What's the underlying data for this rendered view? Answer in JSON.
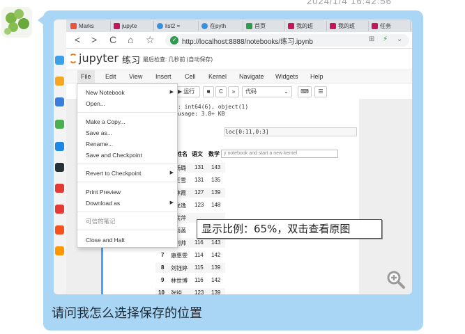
{
  "timestamp": "2024/1/4 16:42:56",
  "message": "请问我怎么选择保存的位置",
  "browser": {
    "tabs": [
      {
        "label": "Marks",
        "color": "#e8553e"
      },
      {
        "label": "jupyte",
        "color": "#c2185b"
      },
      {
        "label": "list2 =",
        "color": "#3b8fd9"
      },
      {
        "label": "在pyth",
        "color": "#3b8fd9"
      },
      {
        "label": "首页",
        "color": "#2e9b4e"
      },
      {
        "label": "我的班",
        "color": "#c2185b"
      },
      {
        "label": "我的班",
        "color": "#c2185b"
      },
      {
        "label": "任务",
        "color": "#c2185b"
      }
    ],
    "url": "http://localhost:8888/notebooks/练习.ipynb"
  },
  "jupyter": {
    "logo": "jupyter",
    "notebook_title": "练习",
    "save_status": "最后检查: 几秒前  (自动保存)",
    "menu": [
      "File",
      "Edit",
      "View",
      "Insert",
      "Cell",
      "Kernel",
      "Navigate",
      "Widgets",
      "Help"
    ],
    "toolbar": {
      "run": "▶ 运行",
      "cell_type": "代码"
    }
  },
  "notebook": {
    "output_lines": [
      ": int64(6), object(1)",
      "usage: 3.8+ KB"
    ],
    "code": "loc[0:11,0:3]",
    "tooltip": "y notebook and start a new kernel"
  },
  "file_menu": [
    {
      "label": "New Notebook",
      "submenu": true
    },
    {
      "label": "Open..."
    },
    {
      "label": "Make a Copy..."
    },
    {
      "label": "Save as..."
    },
    {
      "label": "Rename..."
    },
    {
      "label": "Save and Checkpoint"
    },
    {
      "label": "Revert to Checkpoint",
      "submenu": true
    },
    {
      "label": "Print Preview"
    },
    {
      "label": "Download as",
      "submenu": true
    },
    {
      "label": "可信的笔记",
      "disabled": true
    },
    {
      "label": "Close and Halt"
    }
  ],
  "table": {
    "columns": [
      "姓名",
      "语文",
      "数学"
    ],
    "rows": [
      {
        "idx": "",
        "name": "杨璐",
        "yuwen": "131",
        "shuxue": "143"
      },
      {
        "idx": "",
        "name": "王雪",
        "yuwen": "131",
        "shuxue": "135"
      },
      {
        "idx": "",
        "name": "林霞",
        "yuwen": "127",
        "shuxue": "139"
      },
      {
        "idx": "",
        "name": "龙逸",
        "yuwen": "123",
        "shuxue": "148"
      },
      {
        "idx": "",
        "name": "紫萍",
        "yuwen": "",
        "shuxue": ""
      },
      {
        "idx": "",
        "name": "雨菡",
        "yuwen": "",
        "shuxue": ""
      },
      {
        "idx": "",
        "name": "刘帅",
        "yuwen": "116",
        "shuxue": "143"
      },
      {
        "idx": "7",
        "name": "康惠雯",
        "yuwen": "114",
        "shuxue": "142"
      },
      {
        "idx": "8",
        "name": "刘钰婷",
        "yuwen": "115",
        "shuxue": "139"
      },
      {
        "idx": "9",
        "name": "林世博",
        "yuwen": "116",
        "shuxue": "142"
      },
      {
        "idx": "10",
        "name": "张锐",
        "yuwen": "123",
        "shuxue": "139"
      }
    ]
  },
  "zoom_hint": "显示比例：65%，双击查看原图"
}
